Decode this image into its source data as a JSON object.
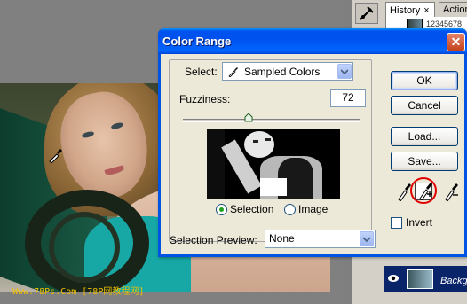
{
  "dialog": {
    "title": "Color Range",
    "select_label": "Select:",
    "select_value": "Sampled Colors",
    "fuzziness_label": "Fuzziness:",
    "fuzziness_value": "72",
    "fuzziness_level_percent": 36,
    "radio_selection": "Selection",
    "radio_image": "Image",
    "selected_view": "Selection",
    "selection_preview_label": "Selection Preview:",
    "selection_preview_value": "None",
    "ok": "OK",
    "cancel": "Cancel",
    "load": "Load...",
    "save": "Save...",
    "invert": "Invert",
    "invert_checked": false,
    "close_glyph": "✕"
  },
  "panels": {
    "history_tab": "History",
    "history_close": "×",
    "actions_tab": "Action",
    "history_item": "12345678",
    "layer_name": "Backgr"
  },
  "watermark": "Www.78Ps.Com [78P网教程网]",
  "colors": {
    "title_bar": "#0054e3",
    "dialog_bg": "#ece9d8",
    "highlight": "#e00000",
    "layer_selected": "#0a246a"
  },
  "icons": {
    "tool": "brush-tool-icon",
    "eyedropper": "eyedropper-icon",
    "eyedropper_add": "eyedropper-plus-icon",
    "eyedropper_subtract": "eyedropper-minus-icon",
    "visibility": "eye-icon",
    "dropdown": "chevron-down-icon"
  }
}
